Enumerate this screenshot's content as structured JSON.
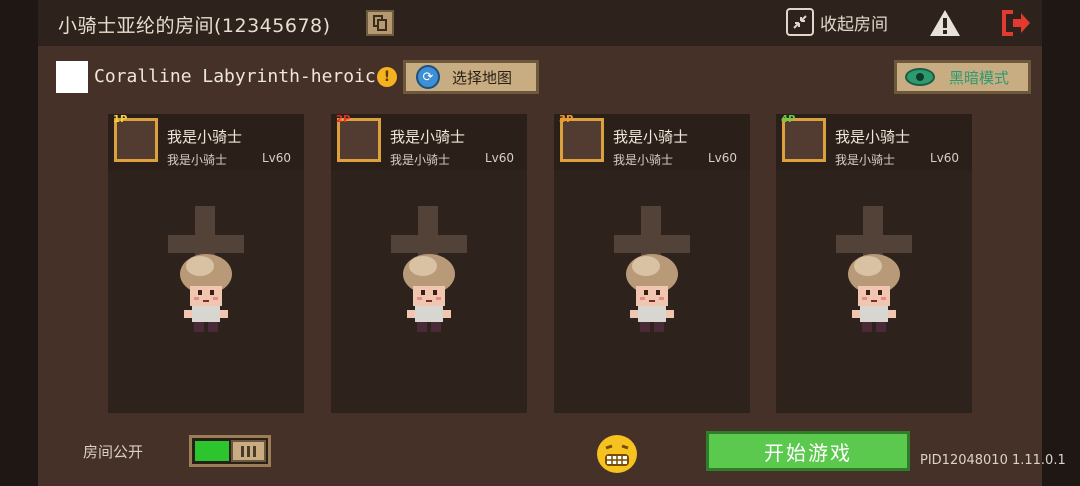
{
  "room": {
    "title": "小骑士亚纶的房间(12345678)",
    "collapse_label": "收起房间"
  },
  "map": {
    "name": "Coralline Labyrinth-heroic",
    "warning_symbol": "!",
    "select_label": "选择地图",
    "mode_label": "黑暗模式"
  },
  "players": [
    {
      "badge": "1P",
      "badge_color": "#f2d23c",
      "name": "我是小骑士",
      "sub": "我是小骑士",
      "level": "Lv60"
    },
    {
      "badge": "2P",
      "badge_color": "#e0322a",
      "name": "我是小骑士",
      "sub": "我是小骑士",
      "level": "Lv60"
    },
    {
      "badge": "3P",
      "badge_color": "#f29a2e",
      "name": "我是小骑士",
      "sub": "我是小骑士",
      "level": "Lv60"
    },
    {
      "badge": "4P",
      "badge_color": "#5fd04a",
      "name": "我是小骑士",
      "sub": "我是小骑士",
      "level": "Lv60"
    }
  ],
  "footer": {
    "public_label": "房间公开",
    "public_on": true,
    "start_label": "开始游戏",
    "pid": "PID12048010 1.11.0.1"
  },
  "icons": {
    "copy": "copy-icon",
    "collapse": "collapse-icon",
    "warning": "warning-icon",
    "exit": "exit-icon",
    "refresh": "refresh-icon",
    "eye": "eye-icon",
    "emoji": "emoji-grin-icon"
  },
  "colors": {
    "panel": "#453127",
    "slot": "#2e221c",
    "accent_gold": "#dca13d",
    "start_green": "#5ac94d",
    "exit_red": "#e23a2e"
  }
}
